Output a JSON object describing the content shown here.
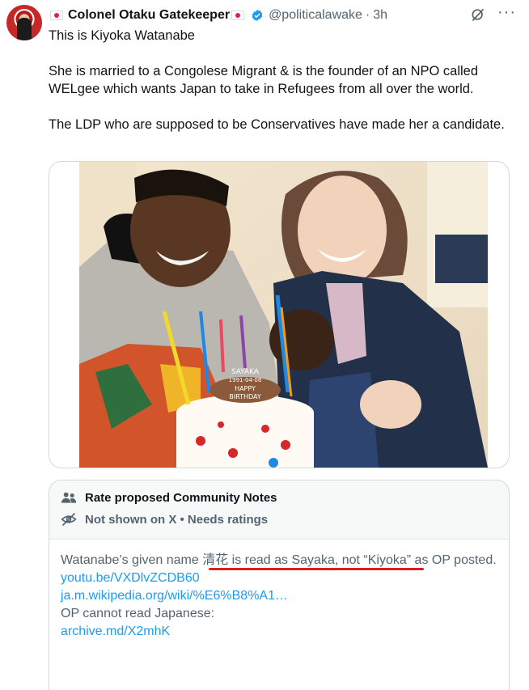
{
  "post": {
    "author_name": "Colonel Otaku Gatekeeper",
    "handle": "@politicalawake",
    "separator": "·",
    "time": "3h",
    "paragraphs": [
      "This is Kiyoka Watanabe",
      "She is married to a Congolese Migrant & is the founder of an NPO called WELgee which wants Japan to take in Refugees from all over the world.",
      "The LDP who are supposed to be Conservatives have made her a candidate."
    ]
  },
  "photo": {
    "cake_text": [
      "SAYAKA",
      "1991-04-08",
      "HAPPY",
      "BIRTHDAY"
    ]
  },
  "community_notes": {
    "title": "Rate proposed Community Notes",
    "status": "Not shown on X • Needs ratings",
    "body_text_1": "Watanabe’s given name ",
    "body_highlight": "清花 is read as Sayaka, not “Kiyoka”",
    "body_text_2": " as OP posted.",
    "link_1": "youtu.be/VXDlvZCDB60",
    "link_2": "ja.m.wikipedia.org/wiki/%E6%B8%A1…",
    "body_text_3": "OP cannot read Japanese:",
    "link_3": "archive.md/X2mhK"
  },
  "colors": {
    "link": "#1d9bf0",
    "muted": "#536471",
    "annotation_underline": "#d91f1f",
    "verified": "#1d9bf0"
  }
}
